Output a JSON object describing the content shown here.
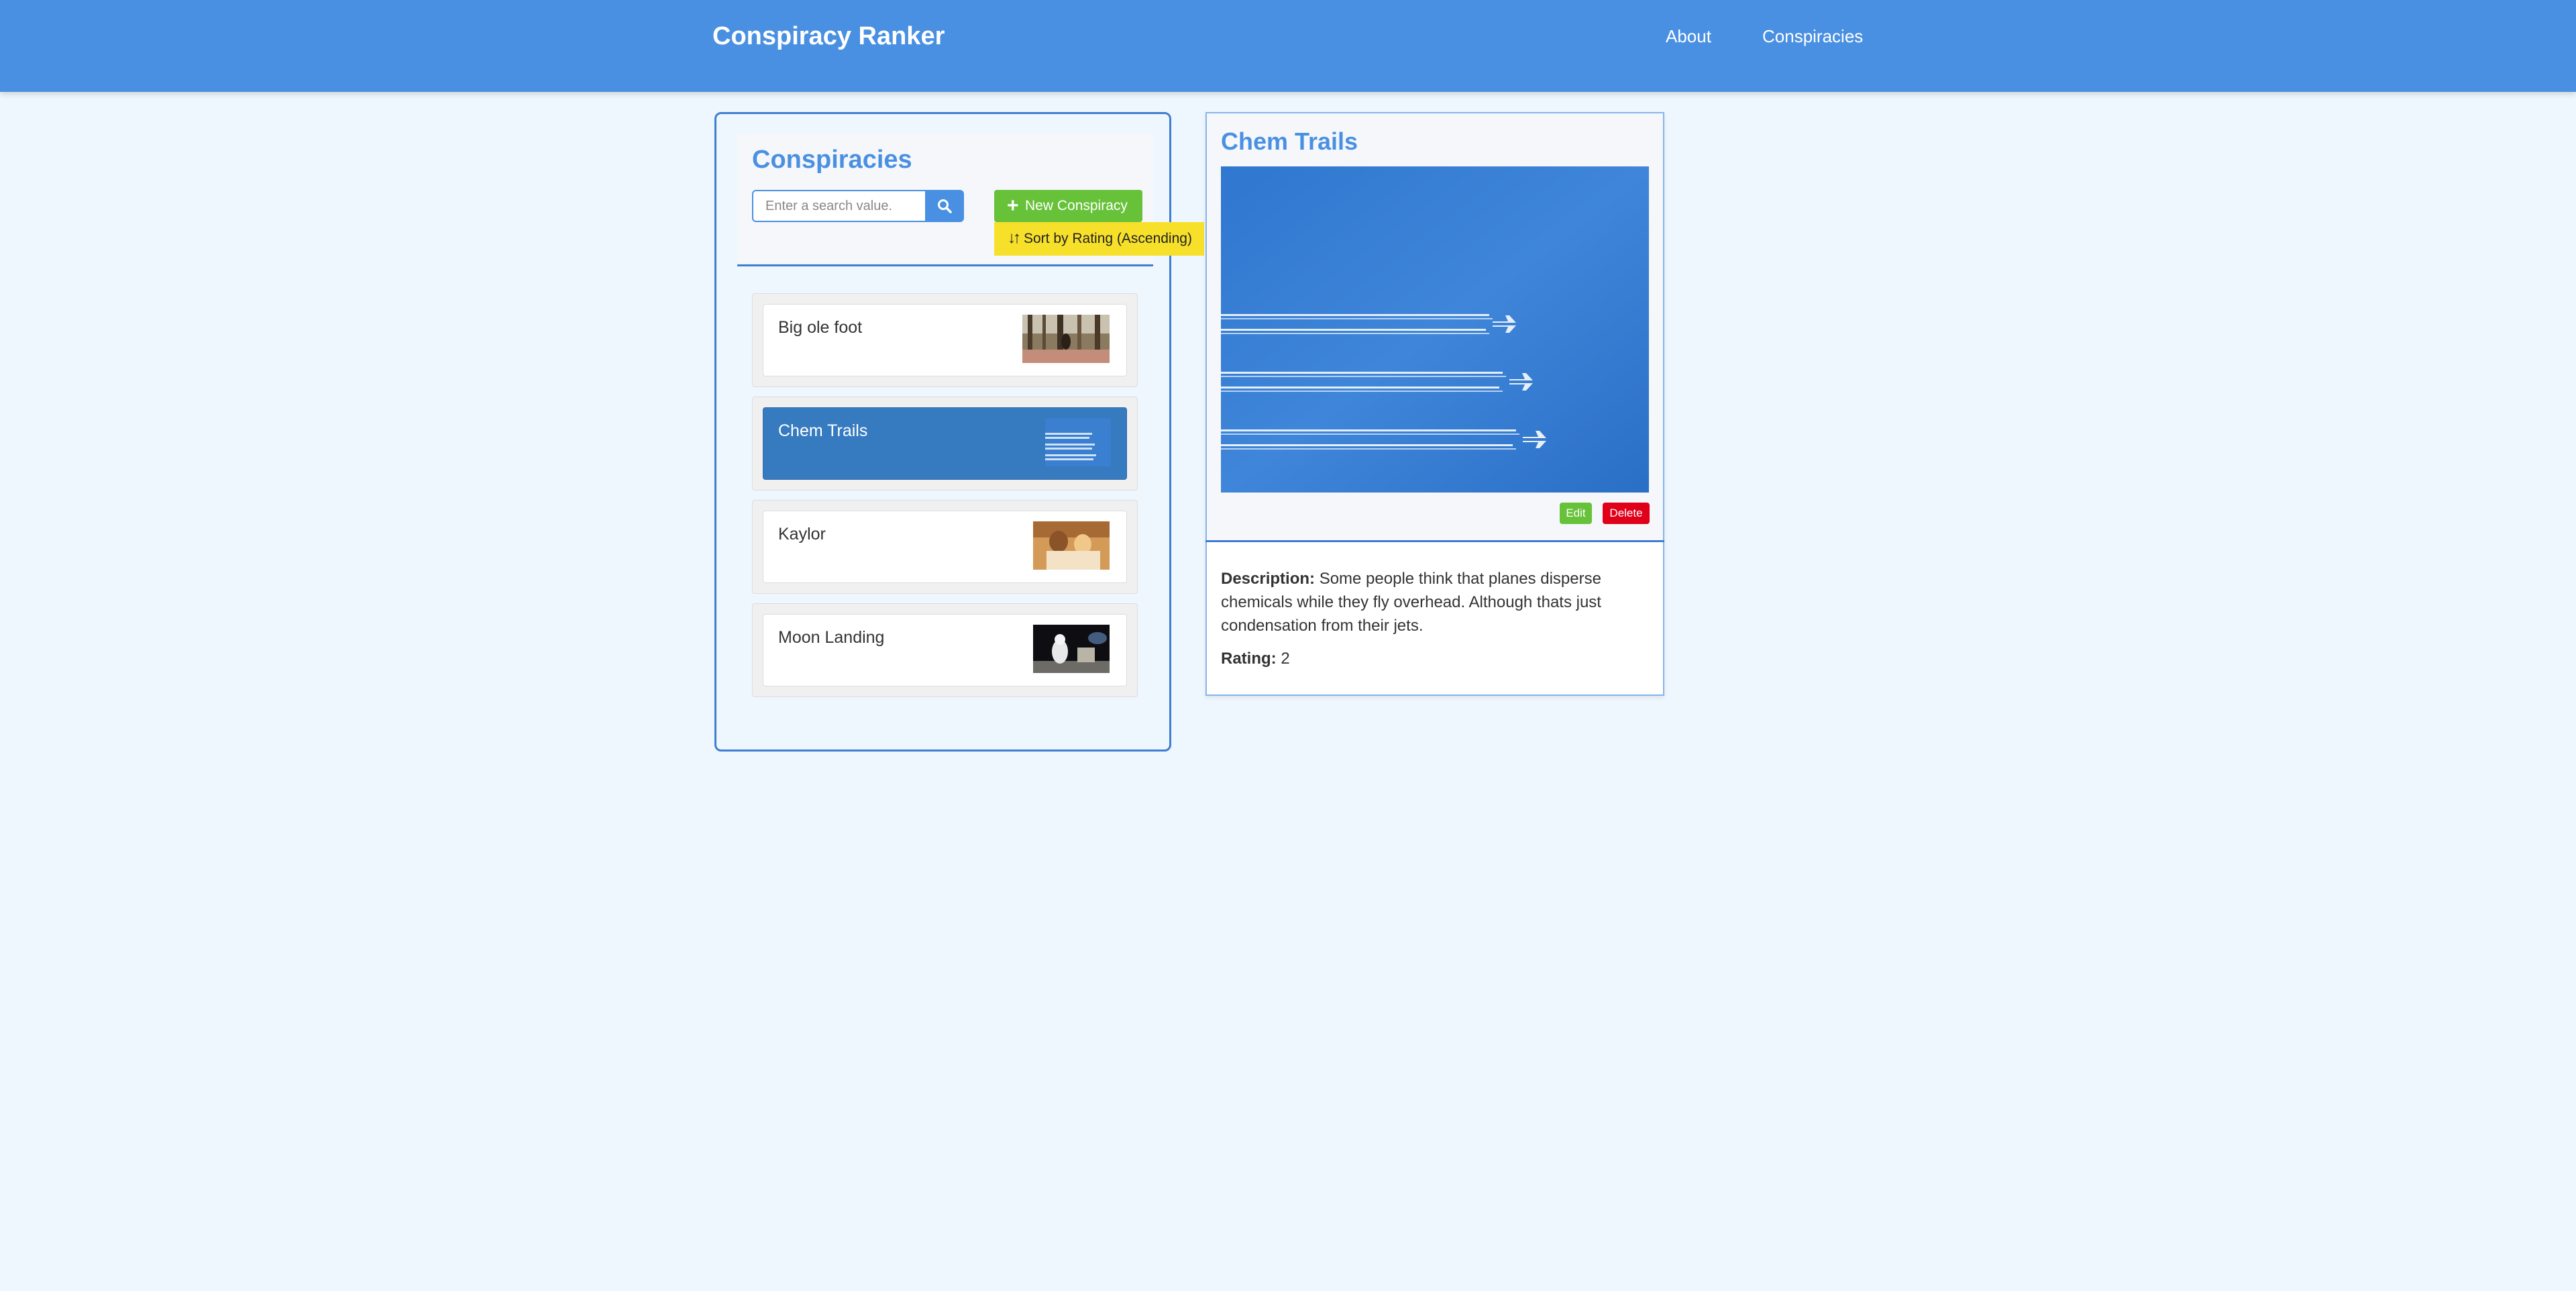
{
  "header": {
    "brand": "Conspiracy Ranker",
    "nav": [
      "About",
      "Conspiracies"
    ]
  },
  "list": {
    "title": "Conspiracies",
    "search_placeholder": "Enter a search value.",
    "search_value": "",
    "new_button": "New Conspiracy",
    "sort_button": "Sort by Rating (Ascending)",
    "items": [
      {
        "name": "Big ole foot",
        "selected": false,
        "thumb": "forest-photo"
      },
      {
        "name": "Chem Trails",
        "selected": true,
        "thumb": "sky-photo"
      },
      {
        "name": "Kaylor",
        "selected": false,
        "thumb": "couple-photo"
      },
      {
        "name": "Moon Landing",
        "selected": false,
        "thumb": "astronaut-photo"
      }
    ]
  },
  "detail": {
    "title": "Chem Trails",
    "edit_button": "Edit",
    "delete_button": "Delete",
    "description_label": "Description:",
    "description": "Some people think that planes disperse chemicals while they fly overhead. Although thats just condensation from their jets.",
    "rating_label": "Rating:",
    "rating": "2"
  },
  "colors": {
    "header": "#4a90e2",
    "accent": "#4a90e2",
    "selected_item": "#367ac0",
    "new_button": "#67c23a",
    "sort_button": "#f7e02a",
    "delete_button": "#e0001a",
    "background": "#eef6fe"
  }
}
